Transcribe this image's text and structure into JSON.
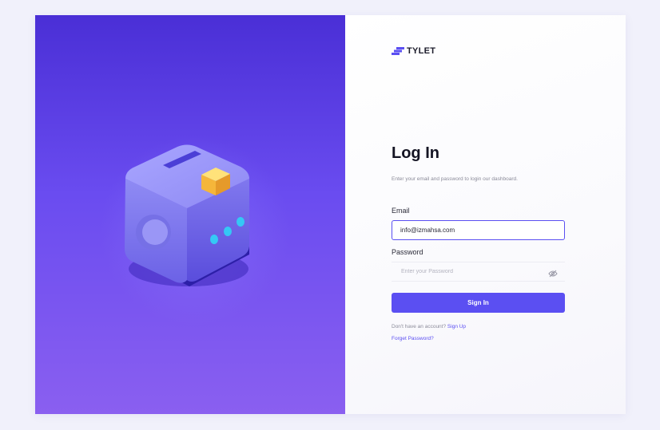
{
  "brand": {
    "name": "TYLET",
    "logo_icon": "stair-logo-icon",
    "accent": "#5b4ff2"
  },
  "login": {
    "title": "Log In",
    "subtitle": "Enter your email and password to login our dashboard.",
    "email": {
      "label": "Email",
      "value": "info@izmahsa.com"
    },
    "password": {
      "label": "Password",
      "placeholder": "Enter your Password",
      "toggle_icon": "eye-off-icon"
    },
    "submit_label": "Sign In",
    "signup_prompt": "Don't have an account?",
    "signup_link": "Sign Up",
    "forgot_link": "Forget Password?"
  },
  "hero": {
    "illustration": "safe-box-illustration",
    "colors": {
      "top": "#4a2fd6",
      "bottom": "#8a5ff0",
      "box": "#8a86f0",
      "gold": "#f5c23a",
      "lights": "#35c8f5"
    }
  }
}
